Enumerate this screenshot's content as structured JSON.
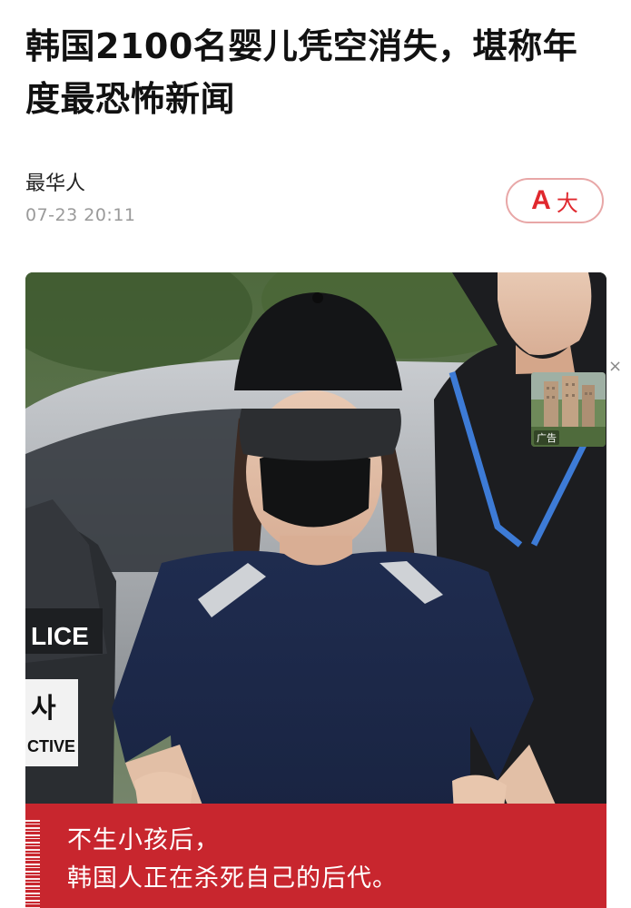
{
  "article": {
    "title": "韩国2100名婴儿凭空消失，堪称年度最恐怖新闻",
    "author": "最华人",
    "timestamp": "07-23 20:11"
  },
  "font_size_button": {
    "icon_letter": "A",
    "label": "大"
  },
  "image": {
    "caption_line_1": "不生小孩后，",
    "caption_line_2": "韩国人正在杀死自己的后代。",
    "police_text_1": "LICE",
    "police_text_2": "사",
    "police_text_3": "CTIVE"
  },
  "ad": {
    "label": "广告",
    "close_symbol": "×"
  },
  "colors": {
    "accent": "#e0282e",
    "caption_band": "#c8262e",
    "timestamp": "#9a9a9a"
  }
}
